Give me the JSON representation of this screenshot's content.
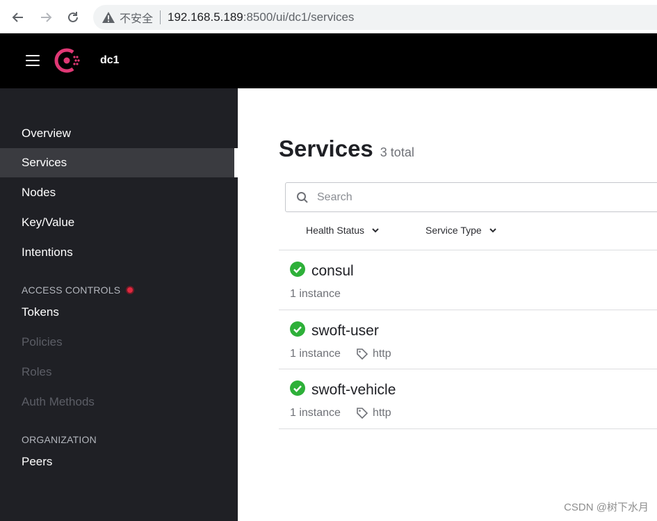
{
  "browser": {
    "insecure_label": "不安全",
    "url_host": "192.168.5.189",
    "url_path": ":8500/ui/dc1/services"
  },
  "header": {
    "datacenter": "dc1"
  },
  "sidebar": {
    "items": [
      {
        "label": "Overview"
      },
      {
        "label": "Services"
      },
      {
        "label": "Nodes"
      },
      {
        "label": "Key/Value"
      },
      {
        "label": "Intentions"
      }
    ],
    "access_controls": {
      "heading": "ACCESS CONTROLS",
      "items": [
        {
          "label": "Tokens"
        },
        {
          "label": "Policies"
        },
        {
          "label": "Roles"
        },
        {
          "label": "Auth Methods"
        }
      ]
    },
    "organization": {
      "heading": "ORGANIZATION",
      "items": [
        {
          "label": "Peers"
        }
      ]
    }
  },
  "main": {
    "title": "Services",
    "count_label": "3 total",
    "search_placeholder": "Search",
    "filters": {
      "health_status": "Health Status",
      "service_type": "Service Type"
    },
    "services": [
      {
        "name": "consul",
        "instances": "1 instance",
        "tag": ""
      },
      {
        "name": "swoft-user",
        "instances": "1 instance",
        "tag": "http"
      },
      {
        "name": "swoft-vehicle",
        "instances": "1 instance",
        "tag": "http"
      }
    ]
  },
  "watermark": "CSDN @树下水月",
  "colors": {
    "brand": "#e03875",
    "passing": "#2eb039",
    "sidebar_bg": "#1f2025"
  }
}
